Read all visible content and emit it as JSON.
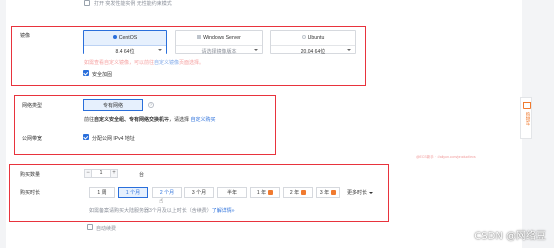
{
  "top": {
    "checkbox_label": "打开 突发性能实例 无性能约束模式"
  },
  "image": {
    "label": "镜像",
    "tabs": [
      {
        "name": "CentOS",
        "version": "8.4 64位",
        "selected": true
      },
      {
        "name": "Windows Server",
        "version": "请选择镜像版本",
        "selected": false
      },
      {
        "name": "Ubuntu",
        "version": "20.04 64位",
        "selected": false
      }
    ],
    "note_prefix": "如需查看自定义镜像，可以前往",
    "note_link": "自定义镜像",
    "note_suffix": "页面选择。",
    "harden_label": "安全加固"
  },
  "network": {
    "type_label": "网络类型",
    "type_value": "专有网络",
    "note_prefix": "前往",
    "note_link1": "自定义安全组、专有网络交换机",
    "note_mid": "等，请选择",
    "note_link2": "自定义购买",
    "bandwidth_label": "公网带宽",
    "bandwidth_checkbox": "分配公网 IPv4 地址"
  },
  "purchase": {
    "qty_label": "购买数量",
    "qty_value": "1",
    "qty_unit": "台",
    "duration_label": "购买时长",
    "durations": [
      {
        "label": "1 周",
        "selected": false,
        "gift": false
      },
      {
        "label": "1 个月",
        "selected": true,
        "gift": false
      },
      {
        "label": "2 个月",
        "selected": false,
        "gift": false
      },
      {
        "label": "3 个月",
        "selected": false,
        "gift": false
      },
      {
        "label": "半年",
        "selected": false,
        "gift": false
      },
      {
        "label": "1 年",
        "selected": false,
        "gift": true
      },
      {
        "label": "2 年",
        "selected": false,
        "gift": true
      },
      {
        "label": "3 年",
        "selected": false,
        "gift": true
      }
    ],
    "more_label": "更多时长",
    "note_prefix": "如需备案请购买大陆服务器3个月及以上时长（含续费）",
    "note_link": "了解详情»",
    "auto_renew": "自动续费"
  },
  "side_cart": {
    "label": "购物车"
  },
  "faint_url": "@ECS新手 · ://aliyun.com/product/ecs",
  "watermark": "CSDN @网络豆",
  "colors": {
    "accent": "#2a6fdb",
    "highlight": "#e8333d",
    "cart": "#f07a2f"
  }
}
